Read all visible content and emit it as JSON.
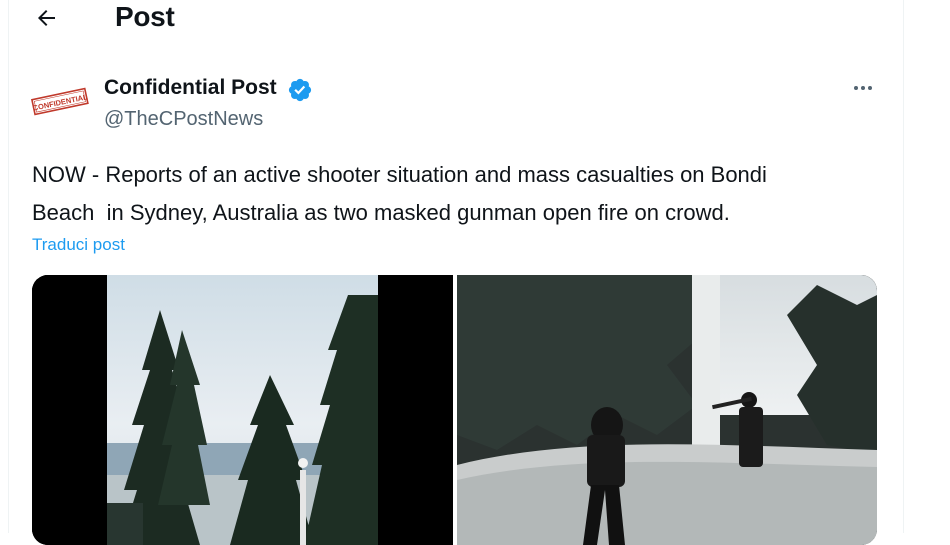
{
  "header": {
    "back_icon": "arrow-left-icon",
    "title": "Post"
  },
  "author": {
    "avatar_text": "CONFIDENTIAL",
    "name": "Confidential Post",
    "verified_icon": "verified-badge-icon",
    "handle": "@TheCPostNews",
    "more_icon": "more-horizontal-icon"
  },
  "tweet": {
    "text": "NOW - Reports of an active shooter situation and mass casualties on Bondi\nBeach  in Sydney, Australia as two masked gunman open fire on crowd.",
    "translate_label": "Traduci post"
  },
  "media": [
    {
      "name": "video-frame-trees"
    },
    {
      "name": "photo-gunmen-bridge"
    }
  ],
  "colors": {
    "accent": "#1d9bf0",
    "text_primary": "#0f1419",
    "text_secondary": "#536471",
    "stamp_red": "#c0392b"
  }
}
